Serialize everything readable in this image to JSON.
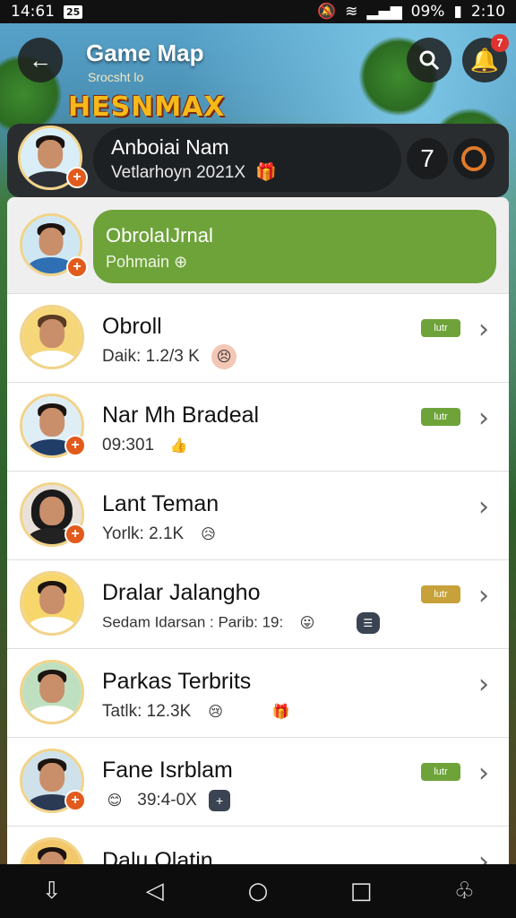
{
  "status_bar": {
    "time_left": "14:61",
    "badge": "25",
    "battery": "09%",
    "time_right": "2:10"
  },
  "header": {
    "title": "Game Map",
    "subtitle": "Srocsht lo",
    "logo": "HESNMAX",
    "back_icon": "arrow-left-icon",
    "search_icon": "search-icon",
    "notif_count": "7"
  },
  "profile": {
    "name": "Anboiai Nam",
    "subtitle": "Vetlarhoyn 2021X",
    "counter": "7"
  },
  "contacts": [
    {
      "name": "ObrolaIJrnal",
      "sub": "Pohmain",
      "emoji": "",
      "tag": "",
      "highlight": true
    },
    {
      "name": "Obroll",
      "sub": "Daik: 1.2/3 K",
      "emoji": "😣",
      "tag": "lutr",
      "tag_color": "#6ea33a"
    },
    {
      "name": "Nar Mh Bradeal",
      "sub": "09:301",
      "emoji": "👍",
      "tag": "lutr",
      "tag_color": "#6ea33a"
    },
    {
      "name": "Lant Teman",
      "sub": "Yorlk: 2.1K",
      "emoji": "😥",
      "tag": "",
      "tag_color": ""
    },
    {
      "name": "Dralar Jalangho",
      "sub": "Sedam Idarsan : Parib: 19:",
      "emoji": "😛",
      "tag": "lutr",
      "tag_color": "#c7a13a"
    },
    {
      "name": "Parkas Terbrits",
      "sub": "Tatlk: 12.3K",
      "emoji": "😢",
      "tag": "",
      "tag_color": ""
    },
    {
      "name": "Fane Isrblam",
      "sub": "39:4-0X",
      "emoji": "😊",
      "tag": "lutr",
      "tag_color": "#6ea33a"
    },
    {
      "name": "Dalu Olatin",
      "sub": "",
      "emoji": "",
      "tag": "",
      "tag_color": ""
    }
  ],
  "nav": {
    "back": "◁",
    "home": "○",
    "recents": "□"
  }
}
